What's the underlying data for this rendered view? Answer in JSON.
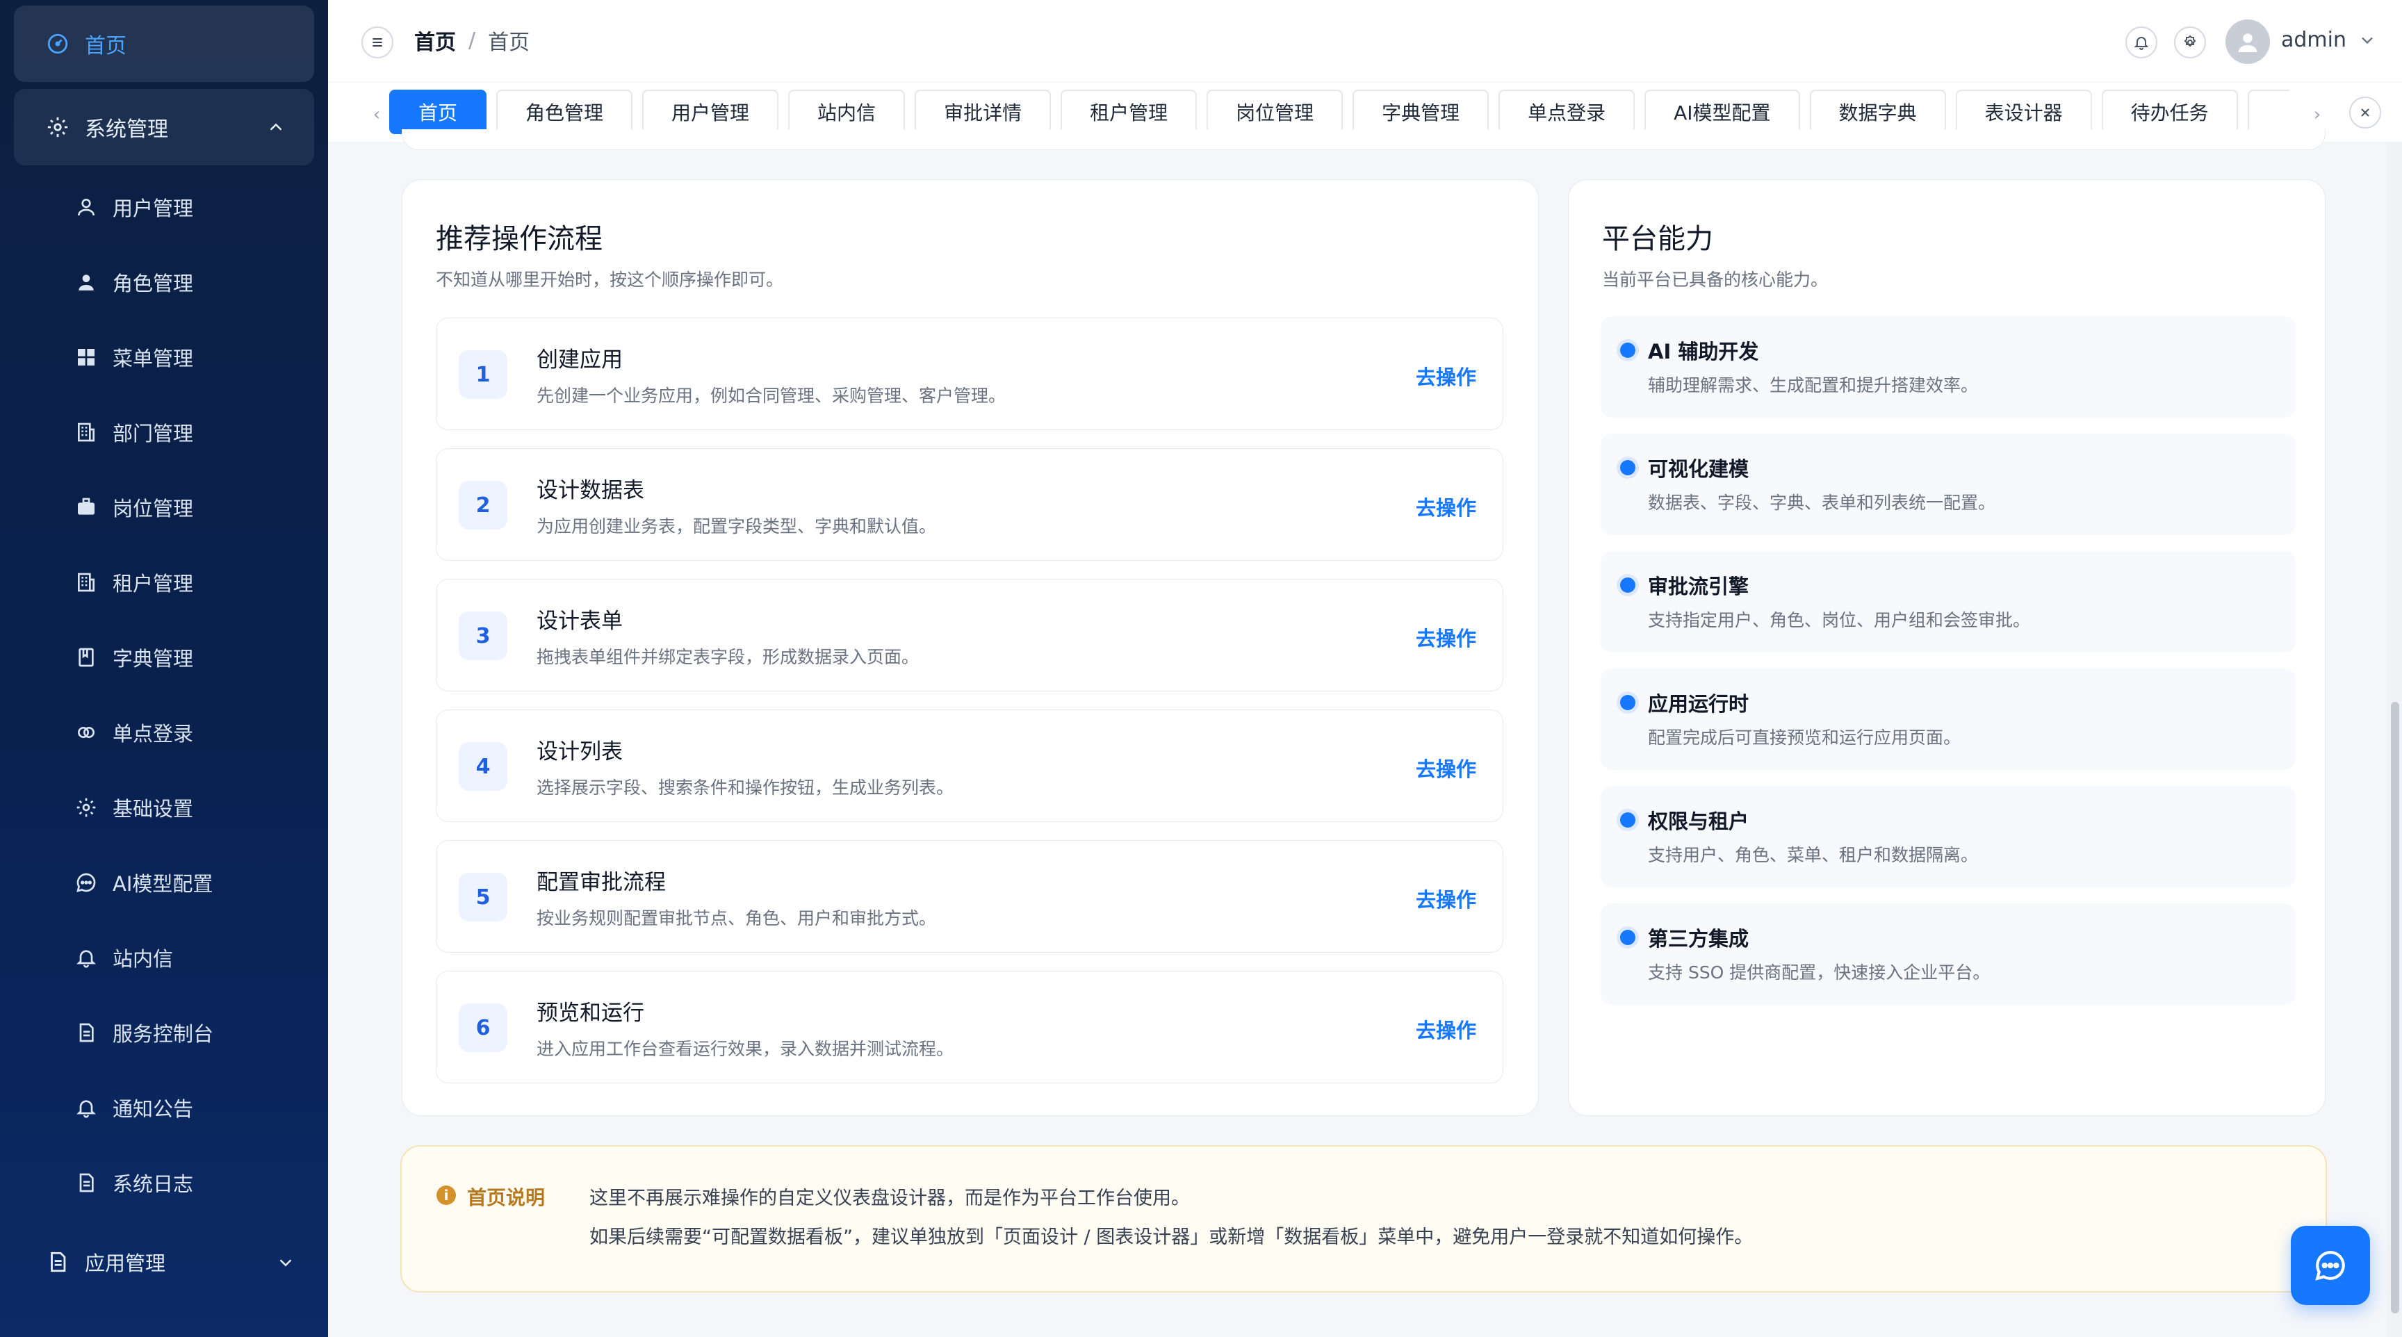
{
  "sidebar": {
    "home_label": "首页",
    "system_group_label": "系统管理",
    "items": [
      {
        "label": "用户管理",
        "icon": "user-icon"
      },
      {
        "label": "角色管理",
        "icon": "role-icon"
      },
      {
        "label": "菜单管理",
        "icon": "grid-icon"
      },
      {
        "label": "部门管理",
        "icon": "building-icon"
      },
      {
        "label": "岗位管理",
        "icon": "briefcase-icon"
      },
      {
        "label": "租户管理",
        "icon": "building-icon"
      },
      {
        "label": "字典管理",
        "icon": "book-icon"
      },
      {
        "label": "单点登录",
        "icon": "link-icon"
      },
      {
        "label": "基础设置",
        "icon": "gear-icon"
      },
      {
        "label": "AI模型配置",
        "icon": "chat-icon"
      },
      {
        "label": "站内信",
        "icon": "bell-icon"
      },
      {
        "label": "服务控制台",
        "icon": "document-icon"
      },
      {
        "label": "通知公告",
        "icon": "bell-icon"
      },
      {
        "label": "系统日志",
        "icon": "document-icon"
      }
    ],
    "app_group_label": "应用管理"
  },
  "header": {
    "breadcrumb": [
      "首页",
      "首页"
    ],
    "breadcrumb_sep": "/",
    "user_name": "admin"
  },
  "tabs": [
    {
      "label": "首页",
      "active": true
    },
    {
      "label": "角色管理"
    },
    {
      "label": "用户管理"
    },
    {
      "label": "站内信"
    },
    {
      "label": "审批详情"
    },
    {
      "label": "租户管理"
    },
    {
      "label": "岗位管理"
    },
    {
      "label": "字典管理"
    },
    {
      "label": "单点登录"
    },
    {
      "label": "AI模型配置"
    },
    {
      "label": "数据字典"
    },
    {
      "label": "表设计器"
    },
    {
      "label": "待办任务"
    }
  ],
  "workflow": {
    "title": "推荐操作流程",
    "subtitle": "不知道从哪里开始时，按这个顺序操作即可。",
    "action_label": "去操作",
    "steps": [
      {
        "num": "1",
        "title": "创建应用",
        "desc": "先创建一个业务应用，例如合同管理、采购管理、客户管理。"
      },
      {
        "num": "2",
        "title": "设计数据表",
        "desc": "为应用创建业务表，配置字段类型、字典和默认值。"
      },
      {
        "num": "3",
        "title": "设计表单",
        "desc": "拖拽表单组件并绑定表字段，形成数据录入页面。"
      },
      {
        "num": "4",
        "title": "设计列表",
        "desc": "选择展示字段、搜索条件和操作按钮，生成业务列表。"
      },
      {
        "num": "5",
        "title": "配置审批流程",
        "desc": "按业务规则配置审批节点、角色、用户和审批方式。"
      },
      {
        "num": "6",
        "title": "预览和运行",
        "desc": "进入应用工作台查看运行效果，录入数据并测试流程。"
      }
    ]
  },
  "capabilities": {
    "title": "平台能力",
    "subtitle": "当前平台已具备的核心能力。",
    "items": [
      {
        "title": "AI 辅助开发",
        "desc": "辅助理解需求、生成配置和提升搭建效率。"
      },
      {
        "title": "可视化建模",
        "desc": "数据表、字段、字典、表单和列表统一配置。"
      },
      {
        "title": "审批流引擎",
        "desc": "支持指定用户、角色、岗位、用户组和会签审批。"
      },
      {
        "title": "应用运行时",
        "desc": "配置完成后可直接预览和运行应用页面。"
      },
      {
        "title": "权限与租户",
        "desc": "支持用户、角色、菜单、租户和数据隔离。"
      },
      {
        "title": "第三方集成",
        "desc": "支持 SSO 提供商配置，快速接入企业平台。"
      }
    ]
  },
  "notice": {
    "label": "首页说明",
    "line1": "这里不再展示难操作的自定义仪表盘设计器，而是作为平台工作台使用。",
    "line2": "如果后续需要“可配置数据看板”，建议单独放到「页面设计 / 图表设计器」或新增「数据看板」菜单中，避免用户一登录就不知道如何操作。"
  },
  "colors": {
    "primary": "#1677ff",
    "sidebar_bg": "#0a2150",
    "notice_bg": "#fffcf3"
  }
}
